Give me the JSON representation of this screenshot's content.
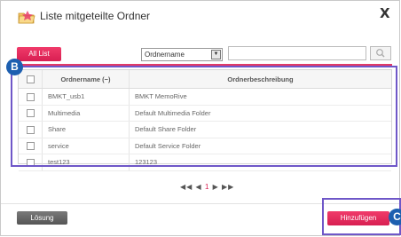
{
  "dialog": {
    "title": "Liste mitgeteilte Ordner",
    "close_label": "X"
  },
  "toolbar": {
    "all_list_label": "All List",
    "filter_selected": "Ordnername",
    "search_value": ""
  },
  "table": {
    "columns": [
      "Ordnername (−)",
      "Ordnerbeschreibung"
    ],
    "rows": [
      {
        "name": "BMKT_usb1",
        "description": "BMKT MemoRive"
      },
      {
        "name": "Multimedia",
        "description": "Default Multimedia Folder"
      },
      {
        "name": "Share",
        "description": "Default Share Folder"
      },
      {
        "name": "service",
        "description": "Default Service Folder"
      },
      {
        "name": "test123",
        "description": "123123"
      }
    ]
  },
  "pagination": {
    "first": "◀◀",
    "prev": "◀",
    "current": "1",
    "next": "▶",
    "last": "▶▶"
  },
  "footer": {
    "losung_label": "Lösung",
    "add_label": "Hinzufügen"
  },
  "annotations": {
    "badge_b": "B",
    "badge_c": "C"
  },
  "colors": {
    "accent": "#e23a67",
    "annotation_border": "#6f57c8",
    "badge": "#1d5fb0"
  }
}
